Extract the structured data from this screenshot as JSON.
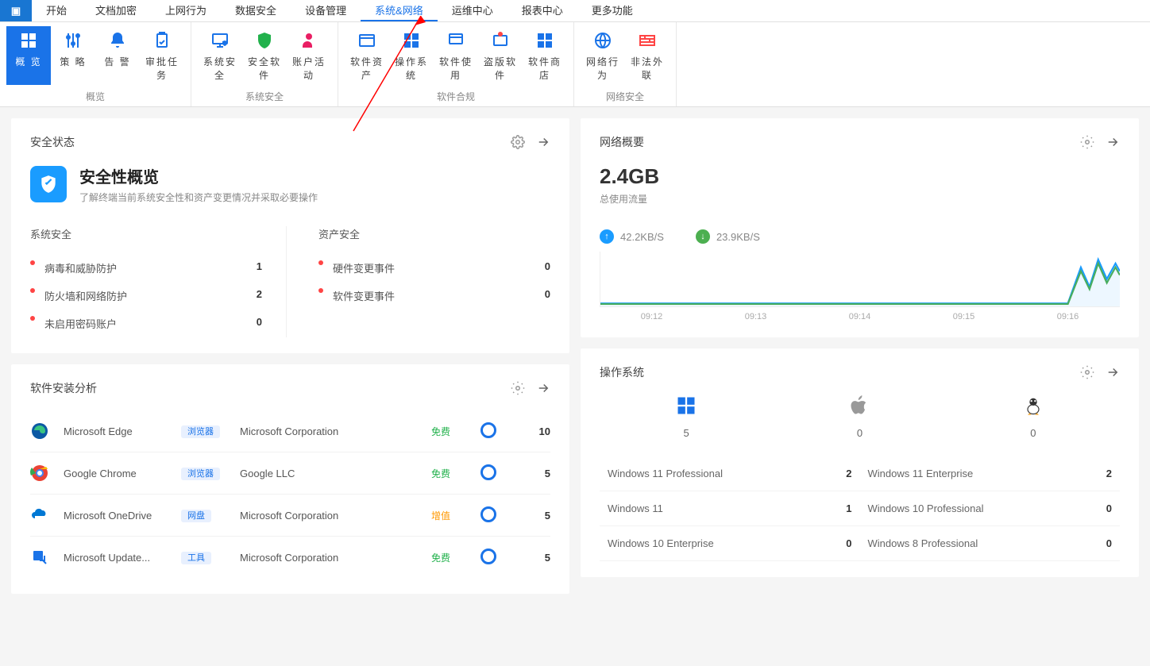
{
  "menu": {
    "items": [
      "开始",
      "文档加密",
      "上网行为",
      "数据安全",
      "设备管理",
      "系统&网络",
      "运维中心",
      "报表中心",
      "更多功能"
    ],
    "activeIndex": 5
  },
  "ribbon": {
    "groups": [
      {
        "label": "概览",
        "items": [
          {
            "label": "概 览",
            "icon": "grid",
            "active": true
          },
          {
            "label": "策 略",
            "icon": "sliders"
          },
          {
            "label": "告 警",
            "icon": "bell"
          },
          {
            "label": "审批任务",
            "icon": "clipboard"
          }
        ]
      },
      {
        "label": "系统安全",
        "items": [
          {
            "label": "系统安全",
            "icon": "monitor-shield"
          },
          {
            "label": "安全软件",
            "icon": "shield"
          },
          {
            "label": "账户活动",
            "icon": "user"
          }
        ]
      },
      {
        "label": "软件合规",
        "items": [
          {
            "label": "软件资产",
            "icon": "window"
          },
          {
            "label": "操作系统",
            "icon": "win"
          },
          {
            "label": "软件使用",
            "icon": "app"
          },
          {
            "label": "盗版软件",
            "icon": "warn"
          },
          {
            "label": "软件商店",
            "icon": "store"
          }
        ]
      },
      {
        "label": "网络安全",
        "items": [
          {
            "label": "网络行为",
            "icon": "globe"
          },
          {
            "label": "非法外联",
            "icon": "firewall"
          }
        ]
      }
    ]
  },
  "securityCard": {
    "header": "安全状态",
    "title": "安全性概览",
    "subtitle": "了解终端当前系统安全性和资产变更情况并采取必要操作",
    "col1": {
      "title": "系统安全",
      "rows": [
        {
          "label": "病毒和威胁防护",
          "value": "1"
        },
        {
          "label": "防火墙和网络防护",
          "value": "2"
        },
        {
          "label": "未启用密码账户",
          "value": "0"
        }
      ]
    },
    "col2": {
      "title": "资产安全",
      "rows": [
        {
          "label": "硬件变更事件",
          "value": "0"
        },
        {
          "label": "软件变更事件",
          "value": "0"
        }
      ]
    }
  },
  "networkCard": {
    "header": "网络概要",
    "total": "2.4GB",
    "totalLabel": "总使用流量",
    "up": "42.2KB/S",
    "down": "23.9KB/S",
    "ticks": [
      "09:12",
      "09:13",
      "09:14",
      "09:15",
      "09:16"
    ]
  },
  "softwareCard": {
    "header": "软件安装分析",
    "rows": [
      {
        "icon": "edge",
        "name": "Microsoft Edge",
        "tag": "浏览器",
        "vendor": "Microsoft Corporation",
        "cost": "免费",
        "costClass": "free",
        "count": "10"
      },
      {
        "icon": "chrome",
        "name": "Google Chrome",
        "tag": "浏览器",
        "vendor": "Google LLC",
        "cost": "免费",
        "costClass": "free",
        "count": "5"
      },
      {
        "icon": "onedrive",
        "name": "Microsoft OneDrive",
        "tag": "网盘",
        "vendor": "Microsoft Corporation",
        "cost": "增值",
        "costClass": "paid",
        "count": "5"
      },
      {
        "icon": "update",
        "name": "Microsoft Update...",
        "tag": "工具",
        "vendor": "Microsoft Corporation",
        "cost": "免费",
        "costClass": "free",
        "count": "5"
      }
    ]
  },
  "osCard": {
    "header": "操作系统",
    "platforms": [
      {
        "icon": "windows",
        "count": "5"
      },
      {
        "icon": "apple",
        "count": "0"
      },
      {
        "icon": "linux",
        "count": "0"
      }
    ],
    "list": [
      {
        "name": "Windows 11 Professional",
        "count": "2"
      },
      {
        "name": "Windows 11 Enterprise",
        "count": "2"
      },
      {
        "name": "Windows 11",
        "count": "1"
      },
      {
        "name": "Windows 10 Professional",
        "count": "0"
      },
      {
        "name": "Windows 10 Enterprise",
        "count": "0"
      },
      {
        "name": "Windows 8 Professional",
        "count": "0"
      }
    ]
  },
  "chart_data": {
    "type": "line",
    "x": [
      "09:12",
      "09:13",
      "09:14",
      "09:15",
      "09:16"
    ],
    "series": [
      {
        "name": "upload",
        "values": [
          2,
          2,
          2,
          2,
          45
        ]
      },
      {
        "name": "download",
        "values": [
          2,
          2,
          2,
          2,
          38
        ]
      }
    ],
    "ylim": [
      0,
      50
    ],
    "ylabel": "KB/s"
  }
}
